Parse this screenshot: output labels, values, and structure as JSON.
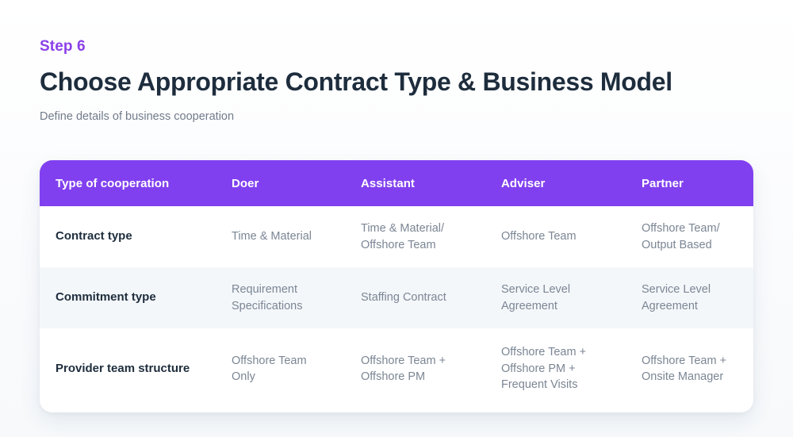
{
  "header": {
    "step_label": "Step 6",
    "title": "Choose Appropriate Contract Type & Business Model",
    "subtitle": "Define details of business cooperation"
  },
  "colors": {
    "accent_purple": "#8140ef",
    "step_text": "#8b3fe8",
    "title_text": "#1e2d3d",
    "subtitle_text": "#717c8a",
    "cell_text": "#7b8694",
    "stripe_bg": "#f4f7fa",
    "card_bg": "#ffffff",
    "page_bg": "#fbfcfe"
  },
  "table": {
    "columns": [
      "Type of cooperation",
      "Doer",
      "Assistant",
      "Adviser",
      "Partner"
    ],
    "rows": [
      {
        "label": "Contract type",
        "cells": [
          "Time & Material",
          "Time & Material/\nOffshore Team",
          "Offshore Team",
          "Offshore Team/\nOutput Based"
        ]
      },
      {
        "label": "Commitment type",
        "cells": [
          "Requirement\nSpecifications",
          "Staffing Contract",
          "Service Level\nAgreement",
          "Service Level\nAgreement"
        ]
      },
      {
        "label": "Provider team structure",
        "cells": [
          "Offshore Team\nOnly",
          "Offshore Team +\nOffshore PM",
          "Offshore Team +\nOffshore PM +\nFrequent Visits",
          "Offshore Team +\nOnsite Manager"
        ]
      }
    ]
  }
}
